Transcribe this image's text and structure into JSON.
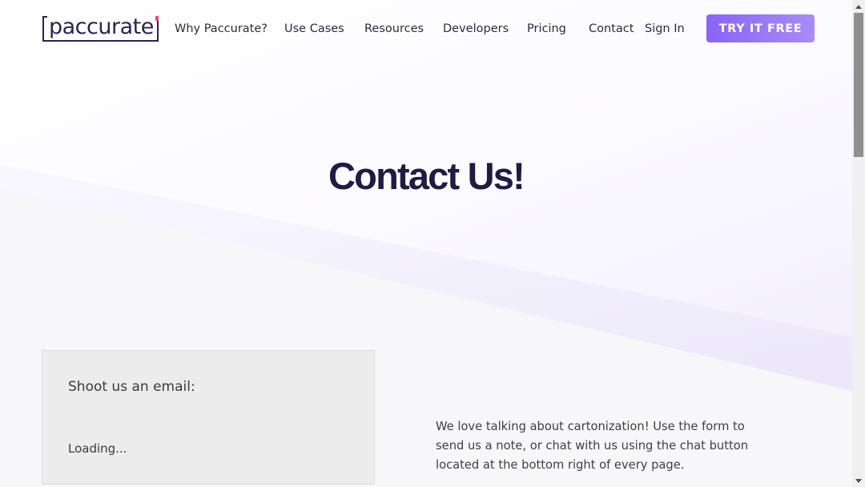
{
  "header": {
    "logo_text": "paccurate",
    "nav": [
      {
        "label": "Why Paccurate?"
      },
      {
        "label": "Use Cases"
      },
      {
        "label": "Resources"
      },
      {
        "label": "Developers"
      },
      {
        "label": "Pricing"
      },
      {
        "label": "Contact"
      },
      {
        "label": "Sign In"
      }
    ],
    "cta_label": "TRY IT FREE"
  },
  "hero": {
    "title": "Contact Us!"
  },
  "email_card": {
    "heading": "Shoot us an email:",
    "status": "Loading..."
  },
  "intro": {
    "text": "We love talking about cartonization! Use the form to send us a note, or chat with us using the chat button located at the bottom right of every page."
  },
  "colors": {
    "brand_dark": "#221a45",
    "accent_purple": "#8a63f5",
    "logo_pink": "#e84a8a"
  }
}
